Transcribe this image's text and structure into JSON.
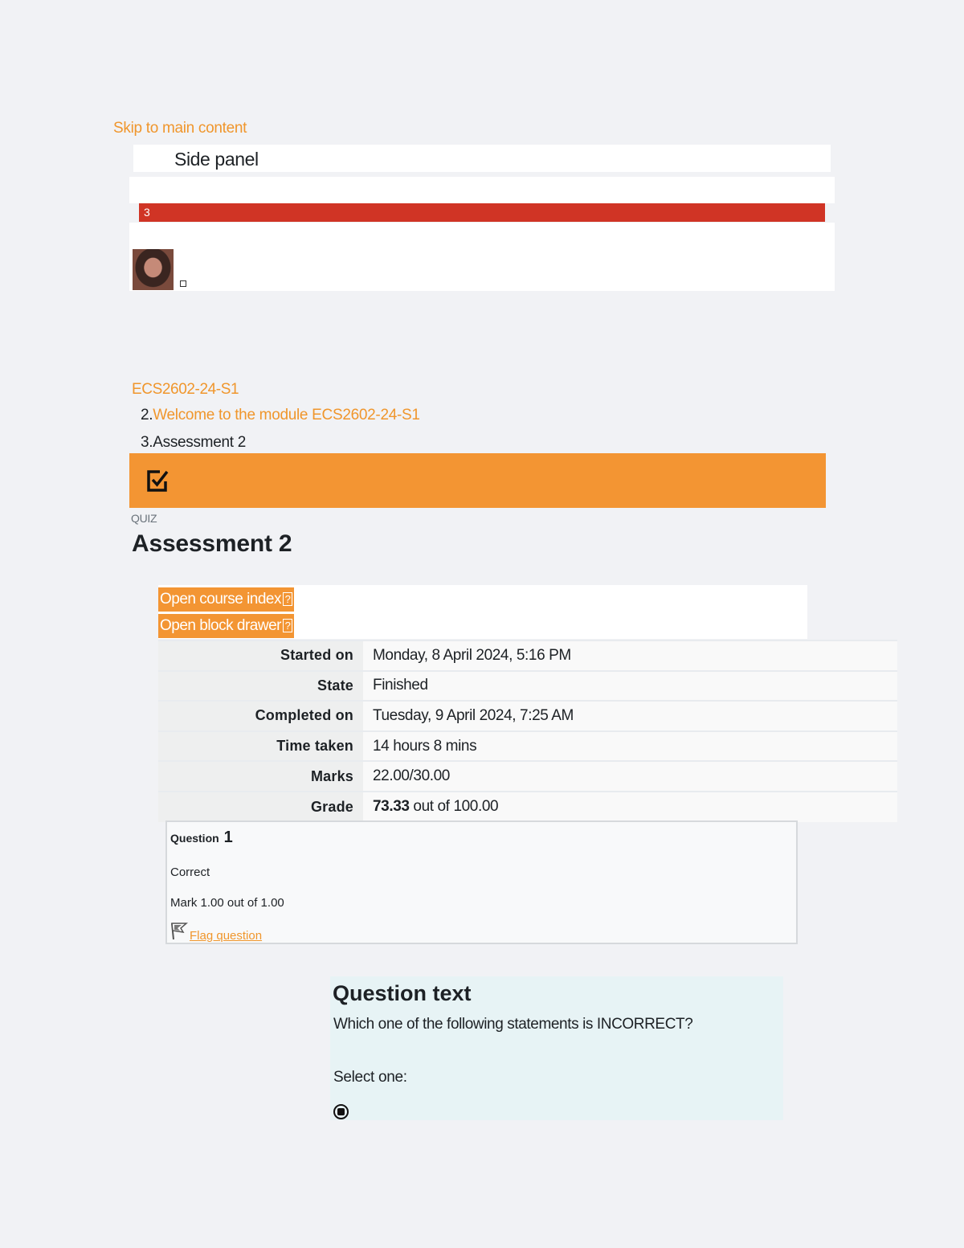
{
  "skip_link": "Skip to main content",
  "side_panel": {
    "title": "Side panel"
  },
  "notifications": {
    "count": "3"
  },
  "breadcrumb": {
    "course": "ECS2602-24-S1",
    "item2_num": "2.",
    "item2_label": "Welcome to the module ECS2602-24-S1",
    "item3": "3.Assessment 2"
  },
  "page_header": {
    "type_label": "QUIZ",
    "title": "Assessment 2",
    "icon": "quiz-check-icon",
    "banner_color": "#f39533"
  },
  "drawers": {
    "course_index": "Open course index",
    "block_drawer": "Open block drawer",
    "glyph": "?"
  },
  "summary": [
    {
      "label": "Started on",
      "value": "Monday, 8 April 2024, 5:16 PM"
    },
    {
      "label": "State",
      "value": "Finished"
    },
    {
      "label": "Completed on",
      "value": "Tuesday, 9 April 2024, 7:25 AM"
    },
    {
      "label": "Time taken",
      "value": "14 hours 8 mins"
    },
    {
      "label": "Marks",
      "value": "22.00/30.00"
    },
    {
      "label": "Grade",
      "value_bold": "73.33",
      "value_rest": " out of 100.00"
    }
  ],
  "question": {
    "label": "Question",
    "number": "1",
    "state": "Correct",
    "mark": "Mark 1.00 out of 1.00",
    "flag_label": "Flag question",
    "text_heading": "Question text",
    "text": "Which one of the following statements is INCORRECT?",
    "select_prompt": "Select one:"
  },
  "colors": {
    "accent": "#f39533",
    "link": "#f0962c",
    "alert": "#d03425"
  }
}
